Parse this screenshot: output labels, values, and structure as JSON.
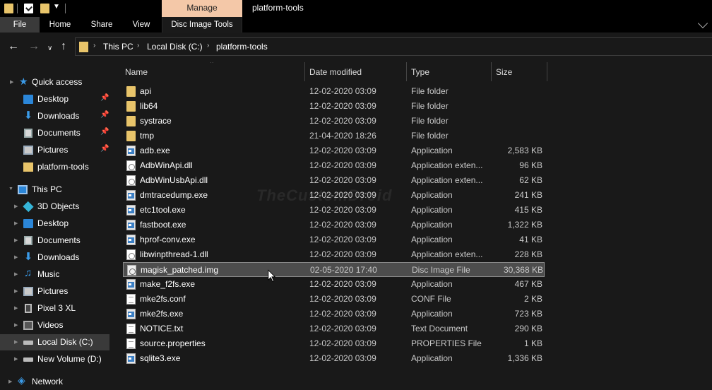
{
  "titlebar": {
    "manage_tab": "Manage",
    "window_title": "platform-tools"
  },
  "ribbon": {
    "tabs": [
      "File",
      "Home",
      "Share",
      "View",
      "Disc Image Tools"
    ]
  },
  "address": {
    "crumbs": [
      "This PC",
      "Local Disk (C:)",
      "platform-tools"
    ]
  },
  "sidebar": {
    "items": [
      {
        "label": "Quick access",
        "icon": "star-icon"
      },
      {
        "label": "Desktop",
        "icon": "desktop-icon",
        "pinned": true
      },
      {
        "label": "Downloads",
        "icon": "downloads-icon",
        "pinned": true
      },
      {
        "label": "Documents",
        "icon": "documents-icon",
        "pinned": true
      },
      {
        "label": "Pictures",
        "icon": "pictures-icon",
        "pinned": true
      },
      {
        "label": "platform-tools",
        "icon": "folder-icon"
      },
      {
        "label": "This PC",
        "icon": "computer-icon"
      },
      {
        "label": "3D Objects",
        "icon": "3d-objects-icon"
      },
      {
        "label": "Desktop",
        "icon": "desktop-icon"
      },
      {
        "label": "Documents",
        "icon": "documents-icon"
      },
      {
        "label": "Downloads",
        "icon": "downloads-icon"
      },
      {
        "label": "Music",
        "icon": "music-icon"
      },
      {
        "label": "Pictures",
        "icon": "pictures-icon"
      },
      {
        "label": "Pixel 3 XL",
        "icon": "phone-icon"
      },
      {
        "label": "Videos",
        "icon": "videos-icon"
      },
      {
        "label": "Local Disk (C:)",
        "icon": "drive-icon",
        "selected": true
      },
      {
        "label": "New Volume (D:)",
        "icon": "drive-icon"
      },
      {
        "label": "Network",
        "icon": "network-icon"
      }
    ]
  },
  "columns": {
    "name": "Name",
    "date": "Date modified",
    "type": "Type",
    "size": "Size"
  },
  "files": [
    {
      "name": "api",
      "date": "12-02-2020 03:09",
      "type": "File folder",
      "size": "",
      "icon": "folder-icon"
    },
    {
      "name": "lib64",
      "date": "12-02-2020 03:09",
      "type": "File folder",
      "size": "",
      "icon": "folder-icon"
    },
    {
      "name": "systrace",
      "date": "12-02-2020 03:09",
      "type": "File folder",
      "size": "",
      "icon": "folder-icon"
    },
    {
      "name": "tmp",
      "date": "21-04-2020 18:26",
      "type": "File folder",
      "size": "",
      "icon": "folder-icon"
    },
    {
      "name": "adb.exe",
      "date": "12-02-2020 03:09",
      "type": "Application",
      "size": "2,583 KB",
      "icon": "application-icon"
    },
    {
      "name": "AdbWinApi.dll",
      "date": "12-02-2020 03:09",
      "type": "Application exten...",
      "size": "96 KB",
      "icon": "dll-icon"
    },
    {
      "name": "AdbWinUsbApi.dll",
      "date": "12-02-2020 03:09",
      "type": "Application exten...",
      "size": "62 KB",
      "icon": "dll-icon"
    },
    {
      "name": "dmtracedump.exe",
      "date": "12-02-2020 03:09",
      "type": "Application",
      "size": "241 KB",
      "icon": "application-icon"
    },
    {
      "name": "etc1tool.exe",
      "date": "12-02-2020 03:09",
      "type": "Application",
      "size": "415 KB",
      "icon": "application-icon"
    },
    {
      "name": "fastboot.exe",
      "date": "12-02-2020 03:09",
      "type": "Application",
      "size": "1,322 KB",
      "icon": "application-icon"
    },
    {
      "name": "hprof-conv.exe",
      "date": "12-02-2020 03:09",
      "type": "Application",
      "size": "41 KB",
      "icon": "application-icon"
    },
    {
      "name": "libwinpthread-1.dll",
      "date": "12-02-2020 03:09",
      "type": "Application exten...",
      "size": "228 KB",
      "icon": "dll-icon"
    },
    {
      "name": "magisk_patched.img",
      "date": "02-05-2020 17:40",
      "type": "Disc Image File",
      "size": "30,368 KB",
      "icon": "disc-image-icon",
      "selected": true
    },
    {
      "name": "make_f2fs.exe",
      "date": "12-02-2020 03:09",
      "type": "Application",
      "size": "467 KB",
      "icon": "application-icon"
    },
    {
      "name": "mke2fs.conf",
      "date": "12-02-2020 03:09",
      "type": "CONF File",
      "size": "2 KB",
      "icon": "document-icon"
    },
    {
      "name": "mke2fs.exe",
      "date": "12-02-2020 03:09",
      "type": "Application",
      "size": "723 KB",
      "icon": "application-icon"
    },
    {
      "name": "NOTICE.txt",
      "date": "12-02-2020 03:09",
      "type": "Text Document",
      "size": "290 KB",
      "icon": "document-icon"
    },
    {
      "name": "source.properties",
      "date": "12-02-2020 03:09",
      "type": "PROPERTIES File",
      "size": "1 KB",
      "icon": "document-icon"
    },
    {
      "name": "sqlite3.exe",
      "date": "12-02-2020 03:09",
      "type": "Application",
      "size": "1,336 KB",
      "icon": "application-icon"
    }
  ],
  "watermark": "TheCustomDroid",
  "colors": {
    "background": "#191919",
    "manage_tab": "#f4c8a8",
    "folder": "#e8c46a",
    "accent": "#3b9be8",
    "selection": "#4d4d4d"
  }
}
